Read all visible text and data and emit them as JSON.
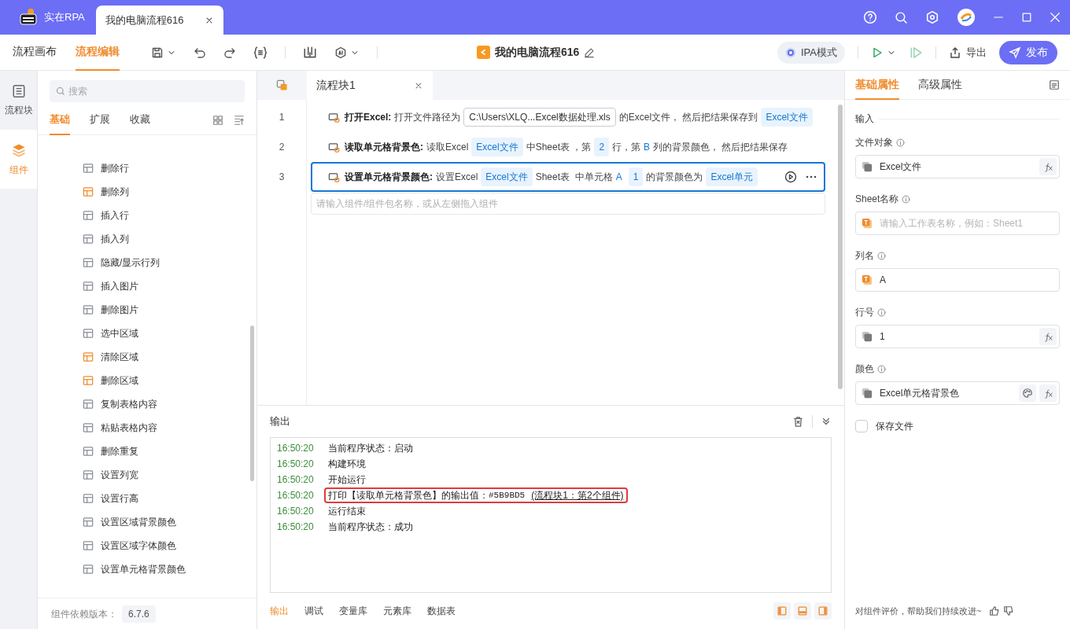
{
  "titlebar": {
    "app_name": "实在RPA",
    "tabs": [
      {
        "label": "我的电脑流程616",
        "selected": true
      }
    ]
  },
  "toolbar": {
    "modes": [
      {
        "label": "流程画布",
        "selected": false
      },
      {
        "label": "流程编辑",
        "selected": true
      }
    ],
    "title": "我的电脑流程616",
    "ipa": "IPA模式",
    "export": "导出",
    "publish": "发布"
  },
  "rail": [
    {
      "label": "流程块",
      "selected": false
    },
    {
      "label": "组件",
      "selected": true
    }
  ],
  "components": {
    "search_placeholder": "搜索",
    "tabs": [
      {
        "label": "基础",
        "selected": true
      },
      {
        "label": "扩展",
        "selected": false
      },
      {
        "label": "收藏",
        "selected": false
      }
    ],
    "items": [
      {
        "label": "删除行",
        "color": "#8a8f99"
      },
      {
        "label": "删除列",
        "color": "#f08c2e"
      },
      {
        "label": "插入行",
        "color": "#8a8f99"
      },
      {
        "label": "插入列",
        "color": "#8a8f99"
      },
      {
        "label": "隐藏/显示行列",
        "color": "#8a8f99"
      },
      {
        "label": "插入图片",
        "color": "#8a8f99"
      },
      {
        "label": "删除图片",
        "color": "#8a8f99"
      },
      {
        "label": "选中区域",
        "color": "#8a8f99"
      },
      {
        "label": "清除区域",
        "color": "#f08c2e"
      },
      {
        "label": "删除区域",
        "color": "#f08c2e"
      },
      {
        "label": "复制表格内容",
        "color": "#8a8f99"
      },
      {
        "label": "粘贴表格内容",
        "color": "#8a8f99"
      },
      {
        "label": "删除重复",
        "color": "#8a8f99"
      },
      {
        "label": "设置列宽",
        "color": "#8a8f99"
      },
      {
        "label": "设置行高",
        "color": "#8a8f99"
      },
      {
        "label": "设置区域背景颜色",
        "color": "#8a8f99"
      },
      {
        "label": "设置区域字体颜色",
        "color": "#8a8f99"
      },
      {
        "label": "设置单元格背景颜色",
        "color": "#8a8f99"
      }
    ],
    "version_label": "组件依赖版本：",
    "version": "6.7.6"
  },
  "editor": {
    "tab": "流程块1",
    "steps": [
      {
        "number": "1",
        "selected": false,
        "title": "打开Excel:",
        "segments": [
          {
            "kind": "text",
            "text": "打开文件路径为"
          },
          {
            "kind": "path",
            "text": "C:\\Users\\XLQ...Excel数据处理.xls"
          },
          {
            "kind": "text",
            "text": "的Excel文件， 然后把结果保存到"
          },
          {
            "kind": "chip",
            "text": "Excel文件"
          }
        ]
      },
      {
        "number": "2",
        "selected": false,
        "title": "读取单元格背景色:",
        "segments": [
          {
            "kind": "text",
            "text": "读取Excel"
          },
          {
            "kind": "chip",
            "text": "Excel文件"
          },
          {
            "kind": "text",
            "text": "中Sheet表 ，第"
          },
          {
            "kind": "chip",
            "text": "2"
          },
          {
            "kind": "text",
            "text": "行，第"
          },
          {
            "kind": "letter",
            "text": "B"
          },
          {
            "kind": "text",
            "text": "列的背景颜色， 然后把结果保存"
          }
        ]
      },
      {
        "number": "3",
        "selected": true,
        "title": "设置单元格背景颜色:",
        "segments": [
          {
            "kind": "text",
            "text": "设置Excel"
          },
          {
            "kind": "chip",
            "text": "Excel文件"
          },
          {
            "kind": "text",
            "text": "Sheet表  中单元格"
          },
          {
            "kind": "letter",
            "text": "A"
          },
          {
            "kind": "chip",
            "text": "1"
          },
          {
            "kind": "text",
            "text": "的背景颜色为"
          },
          {
            "kind": "chip",
            "text": "Excel单元"
          }
        ]
      }
    ],
    "add_placeholder": "请输入组件/组件包名称，或从左侧拖入组件"
  },
  "output": {
    "title": "输出",
    "lines": [
      {
        "time": "16:50:20",
        "text": "当前程序状态：启动",
        "highlighted": false
      },
      {
        "time": "16:50:20",
        "text": "构建环境",
        "highlighted": false
      },
      {
        "time": "16:50:20",
        "text": "开始运行",
        "highlighted": false
      },
      {
        "time": "16:50:20",
        "text": "打印【读取单元格背景色】的输出值：",
        "value": "#5B9BD5",
        "link": "(流程块1：第2个组件)",
        "highlighted": true
      },
      {
        "time": "16:50:20",
        "text": "运行结束",
        "highlighted": false
      },
      {
        "time": "16:50:20",
        "text": "当前程序状态：成功",
        "highlighted": false
      }
    ],
    "tabs": [
      {
        "label": "输出",
        "selected": true
      },
      {
        "label": "调试",
        "selected": false
      },
      {
        "label": "变量库",
        "selected": false
      },
      {
        "label": "元素库",
        "selected": false
      },
      {
        "label": "数据表",
        "selected": false
      }
    ]
  },
  "properties": {
    "tabs": [
      {
        "label": "基础属性",
        "selected": true
      },
      {
        "label": "高级属性",
        "selected": false
      }
    ],
    "section": "输入",
    "fields": [
      {
        "label": "文件对象",
        "kind": "variable",
        "value": "Excel文件",
        "fx": true,
        "palette": false
      },
      {
        "label": "Sheet名称",
        "kind": "text",
        "placeholder": "请输入工作表名称，例如：Sheet1",
        "fx": false,
        "palette": false
      },
      {
        "label": "列名",
        "kind": "text",
        "value": "A",
        "fx": false,
        "palette": false
      },
      {
        "label": "行号",
        "kind": "variable",
        "value": "1",
        "fx": true,
        "palette": false
      },
      {
        "label": "颜色",
        "kind": "variable",
        "value": "Excel单元格背景色",
        "fx": true,
        "palette": true
      }
    ],
    "save_file": {
      "label": "保存文件",
      "checked": false
    },
    "feedback": "对组件评价，帮助我们持续改进~"
  }
}
